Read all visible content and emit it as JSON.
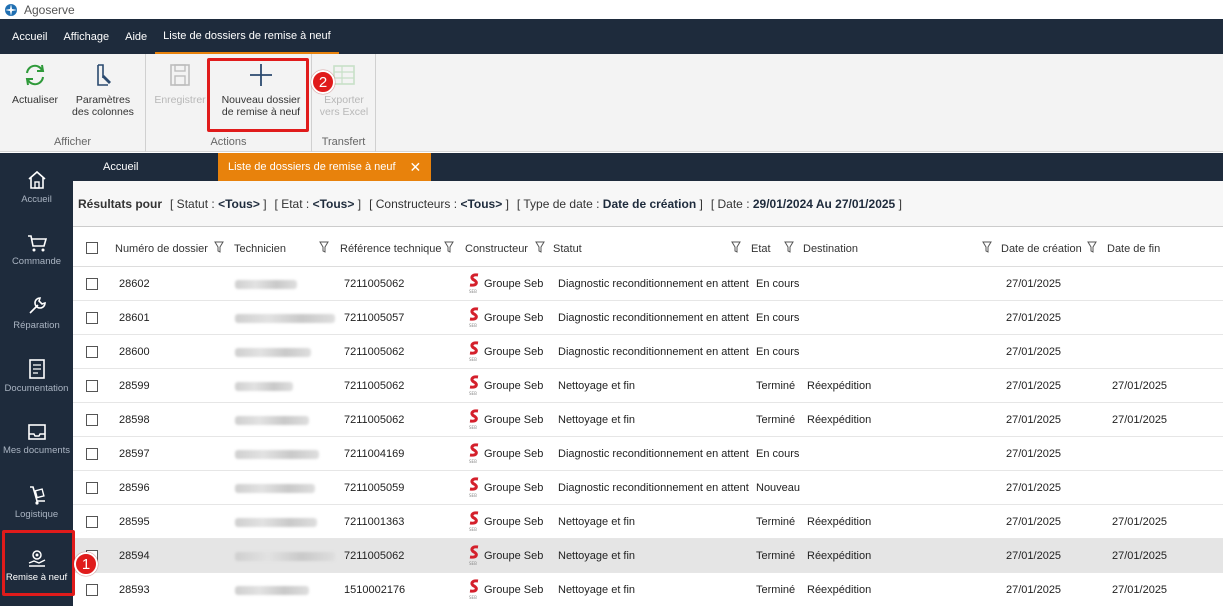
{
  "app": {
    "title": "Agoserve",
    "accent": "#e8820c",
    "navy": "#1e2b3c",
    "highlight": "#e01b1b"
  },
  "menu": [
    "Accueil",
    "Affichage",
    "Aide",
    "Liste de dossiers de remise à neuf"
  ],
  "ribbon": {
    "groups": {
      "afficher": "Afficher",
      "actions": "Actions",
      "transfert": "Transfert"
    },
    "buttons": {
      "actualiser": {
        "line1": "Actualiser",
        "line2": ""
      },
      "parametres": {
        "line1": "Paramètres",
        "line2": "des colonnes"
      },
      "enregistrer": {
        "line1": "Enregistrer",
        "line2": ""
      },
      "nouveau": {
        "line1": "Nouveau dossier",
        "line2": "de remise à neuf"
      },
      "exporter": {
        "line1": "Exporter",
        "line2": "vers Excel"
      }
    }
  },
  "badges": {
    "one": "1",
    "two": "2"
  },
  "sidebar": [
    {
      "label": "Accueil",
      "icon": "home-icon"
    },
    {
      "label": "Commande",
      "icon": "cart-icon"
    },
    {
      "label": "Réparation",
      "icon": "wrench-icon"
    },
    {
      "label": "Documentation",
      "icon": "document-icon"
    },
    {
      "label": "Mes documents",
      "icon": "inbox-icon"
    },
    {
      "label": "Logistique",
      "icon": "hand-truck-icon"
    },
    {
      "label": "Remise à neuf",
      "icon": "refurbish-icon"
    }
  ],
  "tabs": {
    "home": "Accueil",
    "active": "Liste de dossiers de remise à neuf",
    "close": "✕"
  },
  "results": {
    "title": "Résultats pour",
    "statut_label": "[ Statut :",
    "statut_value": "<Tous>",
    "statut_end": "]",
    "etat_label": "[ Etat :",
    "etat_value": "<Tous>",
    "etat_end": "]",
    "constructeurs_label": "[ Constructeurs :",
    "constructeurs_value": "<Tous>",
    "constructeurs_end": "]",
    "typedate_label": "[ Type de date :",
    "typedate_value": "Date de création",
    "typedate_end": "]",
    "date_label": "[ Date :",
    "date_value": "29/01/2024 Au 27/01/2025",
    "date_end": "]"
  },
  "columns": [
    "Numéro de dossier",
    "Technicien",
    "Référence technique",
    "Constructeur",
    "Statut",
    "Etat",
    "Destination",
    "Date de création",
    "Date de fin"
  ],
  "rows": [
    {
      "num": "28602",
      "ref": "7211005062",
      "constructeur": "Groupe Seb",
      "statut": "Diagnostic reconditionnement en attent",
      "etat": "En cours",
      "destination": "",
      "date_creation": "27/01/2025",
      "date_fin": ""
    },
    {
      "num": "28601",
      "ref": "7211005057",
      "constructeur": "Groupe Seb",
      "statut": "Diagnostic reconditionnement en attent",
      "etat": "En cours",
      "destination": "",
      "date_creation": "27/01/2025",
      "date_fin": ""
    },
    {
      "num": "28600",
      "ref": "7211005062",
      "constructeur": "Groupe Seb",
      "statut": "Diagnostic reconditionnement en attent",
      "etat": "En cours",
      "destination": "",
      "date_creation": "27/01/2025",
      "date_fin": ""
    },
    {
      "num": "28599",
      "ref": "7211005062",
      "constructeur": "Groupe Seb",
      "statut": "Nettoyage et fin",
      "etat": "Terminé",
      "destination": "Réexpédition",
      "date_creation": "27/01/2025",
      "date_fin": "27/01/2025"
    },
    {
      "num": "28598",
      "ref": "7211005062",
      "constructeur": "Groupe Seb",
      "statut": "Nettoyage et fin",
      "etat": "Terminé",
      "destination": "Réexpédition",
      "date_creation": "27/01/2025",
      "date_fin": "27/01/2025"
    },
    {
      "num": "28597",
      "ref": "7211004169",
      "constructeur": "Groupe Seb",
      "statut": "Diagnostic reconditionnement en attent",
      "etat": "En cours",
      "destination": "",
      "date_creation": "27/01/2025",
      "date_fin": ""
    },
    {
      "num": "28596",
      "ref": "7211005059",
      "constructeur": "Groupe Seb",
      "statut": "Diagnostic reconditionnement en attent",
      "etat": "Nouveau",
      "destination": "",
      "date_creation": "27/01/2025",
      "date_fin": ""
    },
    {
      "num": "28595",
      "ref": "7211001363",
      "constructeur": "Groupe Seb",
      "statut": "Nettoyage et fin",
      "etat": "Terminé",
      "destination": "Réexpédition",
      "date_creation": "27/01/2025",
      "date_fin": "27/01/2025"
    },
    {
      "num": "28594",
      "ref": "7211005062",
      "constructeur": "Groupe Seb",
      "statut": "Nettoyage et fin",
      "etat": "Terminé",
      "destination": "Réexpédition",
      "date_creation": "27/01/2025",
      "date_fin": "27/01/2025"
    },
    {
      "num": "28593",
      "ref": "1510002176",
      "constructeur": "Groupe Seb",
      "statut": "Nettoyage et fin",
      "etat": "Terminé",
      "destination": "Réexpédition",
      "date_creation": "27/01/2025",
      "date_fin": "27/01/2025"
    }
  ]
}
